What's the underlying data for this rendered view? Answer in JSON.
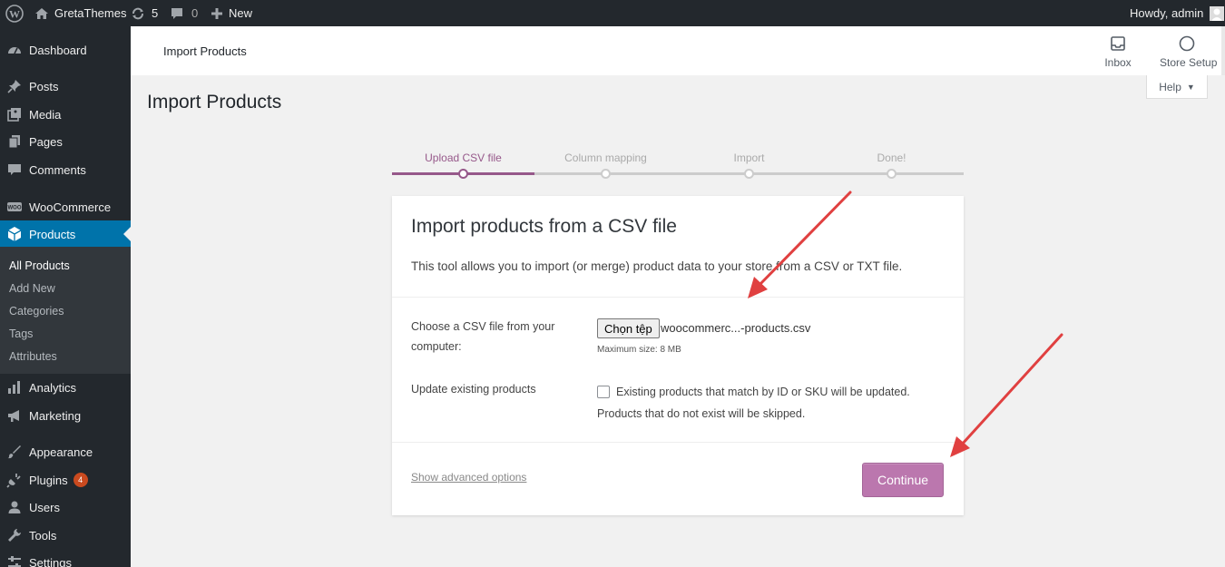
{
  "adminbar": {
    "site_name": "GretaThemes",
    "updates_count": "5",
    "comments_count": "0",
    "new_label": "New",
    "howdy": "Howdy, admin"
  },
  "sidebar": {
    "items": [
      {
        "label": "Dashboard",
        "icon": "dashboard-icon"
      },
      {
        "label": "Posts",
        "icon": "pin-icon"
      },
      {
        "label": "Media",
        "icon": "media-icon"
      },
      {
        "label": "Pages",
        "icon": "pages-icon"
      },
      {
        "label": "Comments",
        "icon": "comment-icon"
      },
      {
        "label": "WooCommerce",
        "icon": "woo-icon"
      },
      {
        "label": "Products",
        "icon": "box-icon"
      },
      {
        "label": "Analytics",
        "icon": "bar-chart-icon"
      },
      {
        "label": "Marketing",
        "icon": "megaphone-icon"
      },
      {
        "label": "Appearance",
        "icon": "brush-icon"
      },
      {
        "label": "Plugins",
        "icon": "plug-icon",
        "badge": "4"
      },
      {
        "label": "Users",
        "icon": "user-icon"
      },
      {
        "label": "Tools",
        "icon": "wrench-icon"
      },
      {
        "label": "Settings",
        "icon": "settings-icon"
      }
    ],
    "submenu": [
      "All Products",
      "Add New",
      "Categories",
      "Tags",
      "Attributes"
    ]
  },
  "header": {
    "title": "Import Products",
    "inbox_label": "Inbox",
    "store_setup_label": "Store Setup",
    "help_label": "Help"
  },
  "page_title": "Import Products",
  "steps": [
    {
      "label": "Upload CSV file",
      "active": true
    },
    {
      "label": "Column mapping",
      "active": false
    },
    {
      "label": "Import",
      "active": false
    },
    {
      "label": "Done!",
      "active": false
    }
  ],
  "card": {
    "heading": "Import products from a CSV file",
    "description": "This tool allows you to import (or merge) product data to your store from a CSV or TXT file.",
    "file_label": "Choose a CSV file from your computer:",
    "file_button": "Chọn tệp",
    "file_name": "woocommerc...-products.csv",
    "max_size": "Maximum size: 8 MB",
    "update_label": "Update existing products",
    "update_text": "Existing products that match by ID or SKU will be updated. Products that do not exist will be skipped.",
    "update_checked": false,
    "advanced_link": "Show advanced options",
    "continue_label": "Continue"
  },
  "colors": {
    "admin_dark": "#23282d",
    "wp_blue": "#0073aa",
    "woo_purple": "#96588a",
    "continue_bg": "#bb77ae",
    "annotation_red": "#e04040"
  }
}
